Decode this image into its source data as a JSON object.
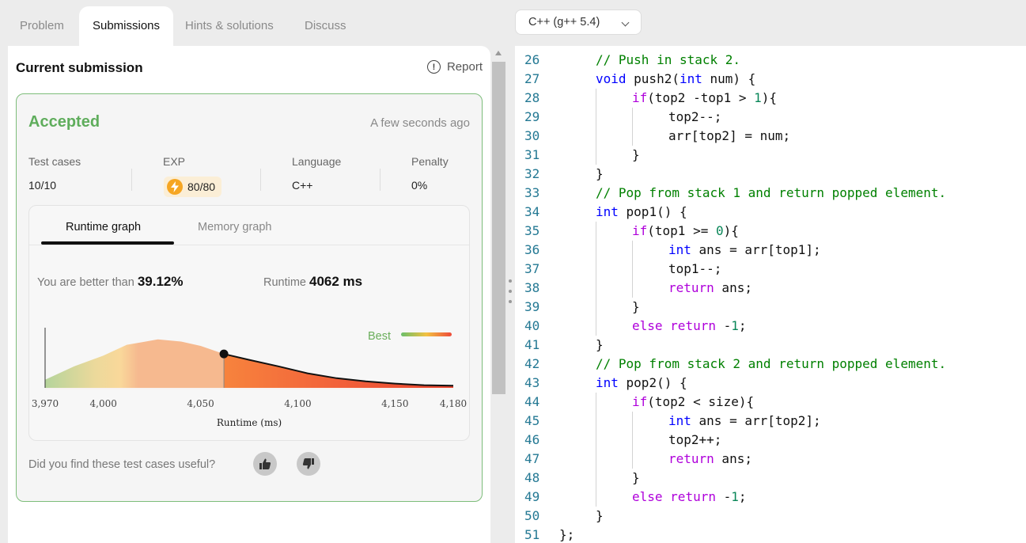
{
  "tabs": [
    "Problem",
    "Submissions",
    "Hints & solutions",
    "Discuss"
  ],
  "panel": {
    "title": "Current submission",
    "report_label": "Report"
  },
  "result": {
    "status": "Accepted",
    "time_ago": "A few seconds ago",
    "stats": {
      "test_cases_label": "Test cases",
      "test_cases_value": "10/10",
      "exp_label": "EXP",
      "exp_value": "80/80",
      "language_label": "Language",
      "language_value": "C++",
      "penalty_label": "Penalty",
      "penalty_value": "0%"
    }
  },
  "graph": {
    "tabs": [
      "Runtime graph",
      "Memory graph"
    ],
    "better_label": "You are better than",
    "better_value": "39.12%",
    "runtime_label": "Runtime",
    "runtime_value": "4062 ms",
    "legend_label": "Best"
  },
  "chart_data": {
    "type": "area",
    "xlabel": "Runtime (ms)",
    "ticks": [
      3970,
      4000,
      4050,
      4100,
      4150,
      4180
    ],
    "tick_labels": [
      "3,970",
      "4,000",
      "4,050",
      "4,100",
      "4,150",
      "4,180"
    ],
    "xlim": [
      3970,
      4180
    ],
    "x": [
      3970,
      3985,
      4000,
      4012,
      4020,
      4028,
      4040,
      4050,
      4058,
      4062,
      4075,
      4090,
      4105,
      4120,
      4135,
      4150,
      4165,
      4180
    ],
    "y": [
      0.15,
      0.4,
      0.6,
      0.8,
      0.85,
      0.9,
      0.86,
      0.78,
      0.68,
      0.63,
      0.52,
      0.4,
      0.27,
      0.18,
      0.12,
      0.08,
      0.05,
      0.04
    ],
    "marker": {
      "x": 4062,
      "y": 0.63
    }
  },
  "feedback": {
    "question": "Did you find these test cases useful?"
  },
  "language_select": {
    "value": "C++ (g++ 5.4)"
  },
  "colors": {
    "accepted": "#5fad5c",
    "comment": "#008000",
    "keyword": "#0000ff",
    "control": "#af00db",
    "line_number": "#237893"
  },
  "code": {
    "lines": [
      {
        "n": "26",
        "indent": 1,
        "t": [
          {
            "c": "com",
            "s": "// Push in stack 2."
          }
        ]
      },
      {
        "n": "27",
        "indent": 1,
        "t": [
          {
            "c": "kw",
            "s": "void"
          },
          {
            "c": "",
            "s": " push2("
          },
          {
            "c": "kw",
            "s": "int"
          },
          {
            "c": "",
            "s": " num) {"
          }
        ]
      },
      {
        "n": "28",
        "indent": 2,
        "t": [
          {
            "c": "ctl",
            "s": "if"
          },
          {
            "c": "",
            "s": "(top2 -top1 > "
          },
          {
            "c": "num",
            "s": "1"
          },
          {
            "c": "",
            "s": "){"
          }
        ]
      },
      {
        "n": "29",
        "indent": 3,
        "t": [
          {
            "c": "",
            "s": "top2--;"
          }
        ]
      },
      {
        "n": "30",
        "indent": 3,
        "t": [
          {
            "c": "",
            "s": "arr[top2] = num;"
          }
        ]
      },
      {
        "n": "31",
        "indent": 2,
        "t": [
          {
            "c": "",
            "s": "}"
          }
        ]
      },
      {
        "n": "32",
        "indent": 1,
        "t": [
          {
            "c": "",
            "s": "}"
          }
        ]
      },
      {
        "n": "33",
        "indent": 1,
        "t": [
          {
            "c": "com",
            "s": "// Pop from stack 1 and return popped element."
          }
        ]
      },
      {
        "n": "34",
        "indent": 1,
        "t": [
          {
            "c": "kw",
            "s": "int"
          },
          {
            "c": "",
            "s": " pop1() {"
          }
        ]
      },
      {
        "n": "35",
        "indent": 2,
        "t": [
          {
            "c": "ctl",
            "s": "if"
          },
          {
            "c": "",
            "s": "(top1 >= "
          },
          {
            "c": "num",
            "s": "0"
          },
          {
            "c": "",
            "s": "){"
          }
        ]
      },
      {
        "n": "36",
        "indent": 3,
        "t": [
          {
            "c": "kw",
            "s": "int"
          },
          {
            "c": "",
            "s": " ans = arr[top1];"
          }
        ]
      },
      {
        "n": "37",
        "indent": 3,
        "t": [
          {
            "c": "",
            "s": "top1--;"
          }
        ]
      },
      {
        "n": "38",
        "indent": 3,
        "t": [
          {
            "c": "ctl",
            "s": "return"
          },
          {
            "c": "",
            "s": " ans;"
          }
        ]
      },
      {
        "n": "39",
        "indent": 2,
        "t": [
          {
            "c": "",
            "s": "}"
          }
        ]
      },
      {
        "n": "40",
        "indent": 2,
        "t": [
          {
            "c": "ctl",
            "s": "else"
          },
          {
            "c": "",
            "s": " "
          },
          {
            "c": "ctl",
            "s": "return"
          },
          {
            "c": "",
            "s": " -"
          },
          {
            "c": "num",
            "s": "1"
          },
          {
            "c": "",
            "s": ";"
          }
        ]
      },
      {
        "n": "41",
        "indent": 1,
        "t": [
          {
            "c": "",
            "s": "}"
          }
        ]
      },
      {
        "n": "42",
        "indent": 1,
        "t": [
          {
            "c": "com",
            "s": "// Pop from stack 2 and return popped element."
          }
        ]
      },
      {
        "n": "43",
        "indent": 1,
        "t": [
          {
            "c": "kw",
            "s": "int"
          },
          {
            "c": "",
            "s": " pop2() {"
          }
        ]
      },
      {
        "n": "44",
        "indent": 2,
        "t": [
          {
            "c": "ctl",
            "s": "if"
          },
          {
            "c": "",
            "s": "(top2 < size){"
          }
        ]
      },
      {
        "n": "45",
        "indent": 3,
        "t": [
          {
            "c": "kw",
            "s": "int"
          },
          {
            "c": "",
            "s": " ans = arr[top2];"
          }
        ]
      },
      {
        "n": "46",
        "indent": 3,
        "t": [
          {
            "c": "",
            "s": "top2++;"
          }
        ]
      },
      {
        "n": "47",
        "indent": 3,
        "t": [
          {
            "c": "ctl",
            "s": "return"
          },
          {
            "c": "",
            "s": " ans;"
          }
        ]
      },
      {
        "n": "48",
        "indent": 2,
        "t": [
          {
            "c": "",
            "s": "}"
          }
        ]
      },
      {
        "n": "49",
        "indent": 2,
        "t": [
          {
            "c": "ctl",
            "s": "else"
          },
          {
            "c": "",
            "s": " "
          },
          {
            "c": "ctl",
            "s": "return"
          },
          {
            "c": "",
            "s": " -"
          },
          {
            "c": "num",
            "s": "1"
          },
          {
            "c": "",
            "s": ";"
          }
        ]
      },
      {
        "n": "50",
        "indent": 1,
        "t": [
          {
            "c": "",
            "s": "}"
          }
        ]
      },
      {
        "n": "51",
        "indent": 0,
        "t": [
          {
            "c": "",
            "s": "};"
          }
        ]
      }
    ]
  }
}
